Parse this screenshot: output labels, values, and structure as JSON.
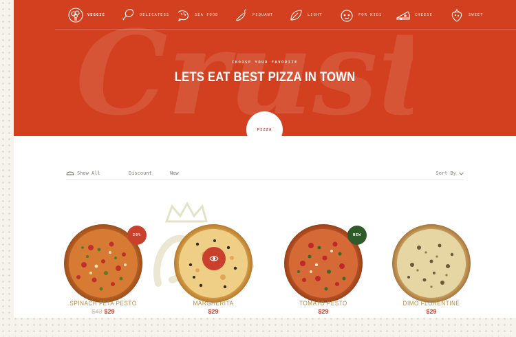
{
  "colors": {
    "brand_red": "#d2401f",
    "accent_red": "#c9402c",
    "gold": "#b38b3c",
    "badge_green": "#2f5a2a"
  },
  "hero": {
    "script_word": "Crust",
    "subtitle": "CHOOSE YOUR FAVORITE",
    "title": "LETS EAT BEST PIZZA IN TOWN"
  },
  "categories": [
    {
      "label": "VEGGIE",
      "icon": "broccoli-icon",
      "active": true
    },
    {
      "label": "DELICATESS",
      "icon": "drumstick-icon",
      "active": false
    },
    {
      "label": "SEA FOOD",
      "icon": "shrimp-icon",
      "active": false
    },
    {
      "label": "PIQUANT",
      "icon": "chili-pepper-icon",
      "active": false
    },
    {
      "label": "LIGHT",
      "icon": "leaf-icon",
      "active": false
    },
    {
      "label": "FOR KIDS",
      "icon": "child-face-icon",
      "active": false
    },
    {
      "label": "CHEESE",
      "icon": "cheese-icon",
      "active": false
    },
    {
      "label": "SWEET",
      "icon": "strawberry-icon",
      "active": false
    }
  ],
  "pizza_tab": "PIZZA",
  "filters": {
    "show_all": "Show All",
    "discount": "Discount",
    "new": "New",
    "sort": "Sort By"
  },
  "products": [
    {
      "name": "SPINACH FETA PESTO",
      "old_price": "$43",
      "price": "$29",
      "badge": "20%",
      "badge_color": "#c9402c"
    },
    {
      "name": "MARGHERITA",
      "old_price": "",
      "price": "$29",
      "badge": "",
      "badge_color": ""
    },
    {
      "name": "TOMATO PESTO",
      "old_price": "",
      "price": "$29",
      "badge": "NEW",
      "badge_color": "#2f5a2a"
    },
    {
      "name": "DIMO FLORENTINE",
      "old_price": "",
      "price": "$29",
      "badge": "",
      "badge_color": ""
    }
  ]
}
